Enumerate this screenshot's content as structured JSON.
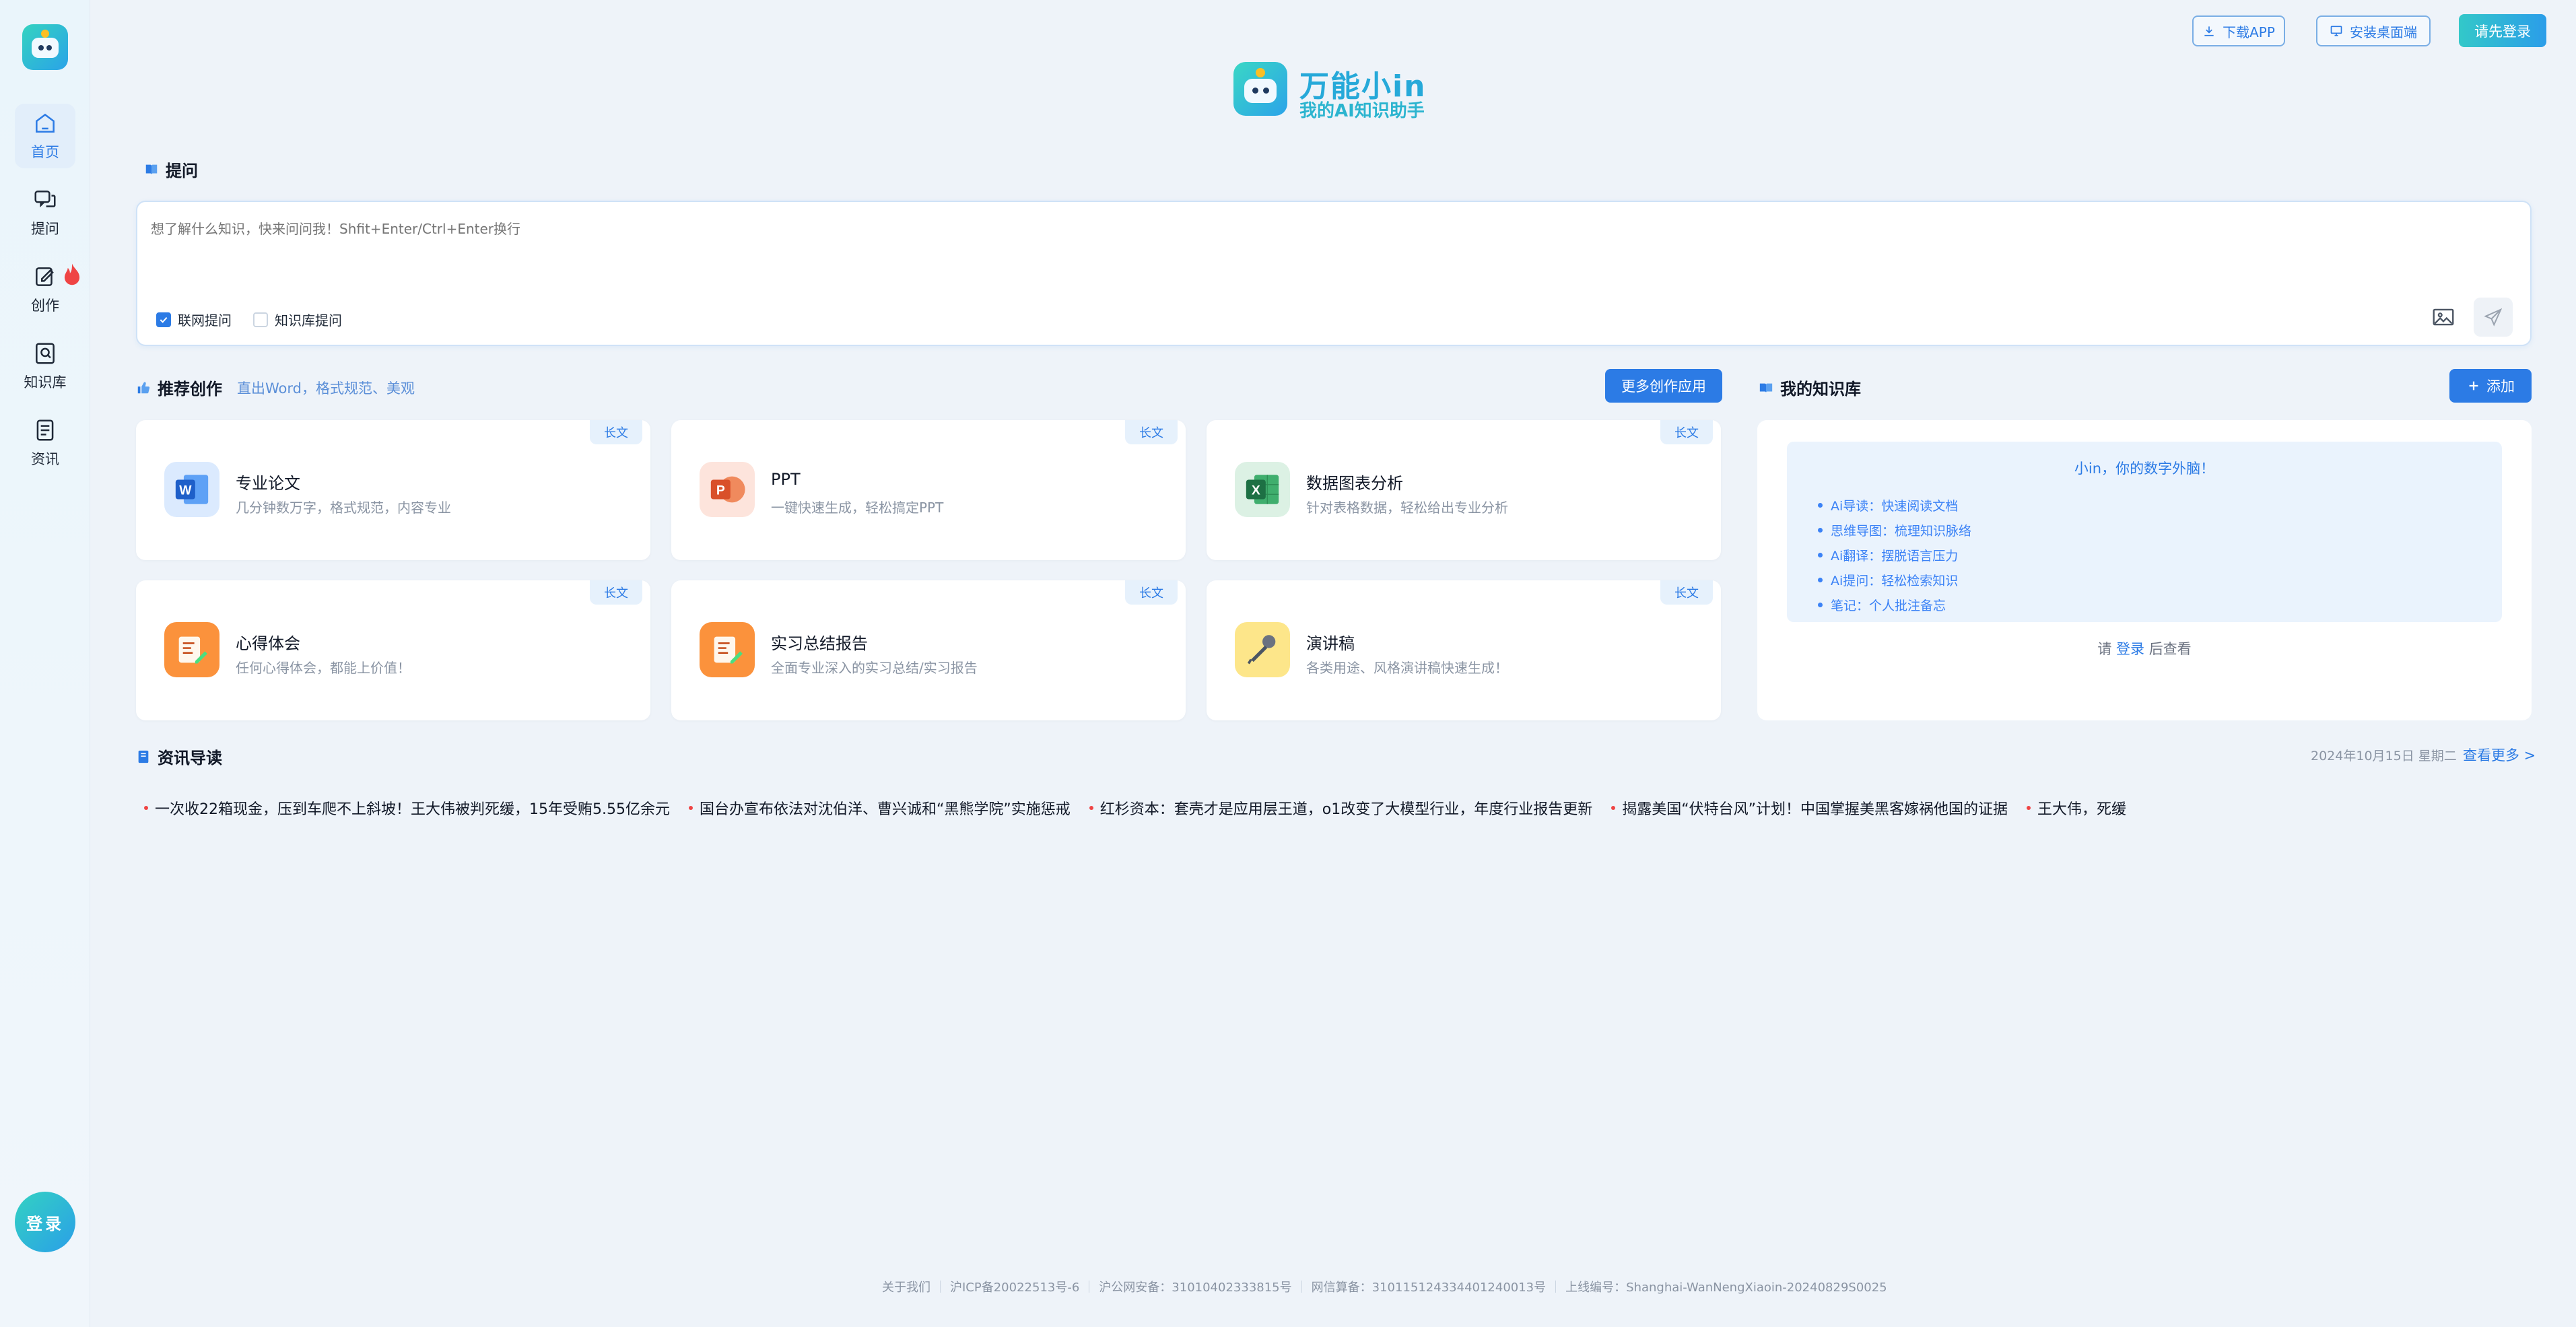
{
  "app": {
    "name": "万能小in",
    "tagline": "我的AI知识助手"
  },
  "sidebar": {
    "items": [
      {
        "label": "首页",
        "icon": "home-icon",
        "active": true
      },
      {
        "label": "提问",
        "icon": "chat-icon"
      },
      {
        "label": "创作",
        "icon": "edit-icon",
        "hot": true
      },
      {
        "label": "知识库",
        "icon": "knowledge-icon"
      },
      {
        "label": "资讯",
        "icon": "news-icon"
      }
    ],
    "login_label": "登录"
  },
  "header": {
    "download_app": "下载APP",
    "install_desktop": "安装桌面端",
    "login": "请先登录"
  },
  "ask": {
    "section_title": "提问",
    "placeholder": "想了解什么知识，快来问问我！Shfit+Enter/Ctrl+Enter换行",
    "option_web": "联网提问",
    "option_web_checked": true,
    "option_kb": "知识库提问",
    "option_kb_checked": false
  },
  "recommend": {
    "title": "推荐创作",
    "subtitle": "直出Word，格式规范、美观",
    "more_button": "更多创作应用",
    "cards": [
      {
        "title": "专业论文",
        "desc": "几分钟数万字，格式规范，内容专业",
        "tag": "长文",
        "icon": "word-icon"
      },
      {
        "title": "PPT",
        "desc": "一键快速生成，轻松搞定PPT",
        "tag": "长文",
        "icon": "ppt-icon"
      },
      {
        "title": "数据图表分析",
        "desc": "针对表格数据，轻松给出专业分析",
        "tag": "长文",
        "icon": "excel-icon"
      },
      {
        "title": "心得体会",
        "desc": "任何心得体会，都能上价值！",
        "tag": "长文",
        "icon": "notes-icon"
      },
      {
        "title": "实习总结报告",
        "desc": "全面专业深入的实习总结/实习报告",
        "tag": "长文",
        "icon": "report-icon"
      },
      {
        "title": "演讲稿",
        "desc": "各类用途、风格演讲稿快速生成！",
        "tag": "长文",
        "icon": "microphone-icon"
      }
    ]
  },
  "knowledge": {
    "title": "我的知识库",
    "add_button": "添加",
    "headline": "小in，你的数字外脑！",
    "features": [
      "Ai导读：快速阅读文档",
      "思维导图：梳理知识脉络",
      "Ai翻译：摆脱语言压力",
      "Ai提问：轻松检索知识",
      "笔记：个人批注备忘"
    ],
    "login_prefix": "请",
    "login_link": "登录",
    "login_suffix": "后查看"
  },
  "news": {
    "title": "资讯导读",
    "date": "2024年10月15日 星期二",
    "more": "查看更多 >",
    "items": [
      "一次收22箱现金，压到车爬不上斜坡！王大伟被判死缓，15年受贿5.55亿余元",
      "国台办宣布依法对沈伯洋、曹兴诚和“黑熊学院”实施惩戒",
      "红杉资本：套壳才是应用层王道，o1改变了大模型行业，年度行业报告更新",
      "揭露美国“伏特台风”计划！中国掌握美黑客嫁祸他国的证据",
      "王大伟，死缓"
    ]
  },
  "footer": {
    "items": [
      "关于我们",
      "沪ICP备20022513号-6",
      "沪公网安备：31010402333815号",
      "网信算备：310115124334401240013号",
      "上线编号：Shanghai-WanNengXiaoin-20240829S0025"
    ]
  },
  "colors": {
    "accent": "#2c7be5",
    "brand_teal": "#33d2c2",
    "background": "#eef3f9"
  }
}
